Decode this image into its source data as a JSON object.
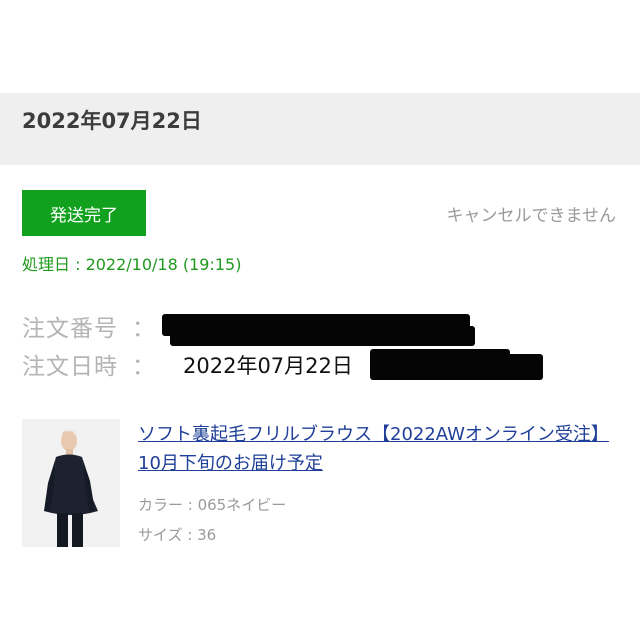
{
  "order": {
    "date_heading": "2022年07月22日",
    "status_label": "発送完了",
    "cancel_note": "キャンセルできません",
    "processed": "処理日 : 2022/10/18 (19:15)",
    "order_number_label": "注文番号",
    "order_datetime_label": "注文日時",
    "colon": "：",
    "order_datetime_value": "2022年07月22日"
  },
  "product": {
    "name": "ソフト裏起毛フリルブラウス【2022AWオンライン受注】 10月下旬のお届け予定",
    "color": "カラー : 065ネイビー",
    "size": "サイズ : 36"
  },
  "colors": {
    "status_green": "#12a11f",
    "link_blue": "#1f3f99",
    "band_gray": "#efefef"
  }
}
